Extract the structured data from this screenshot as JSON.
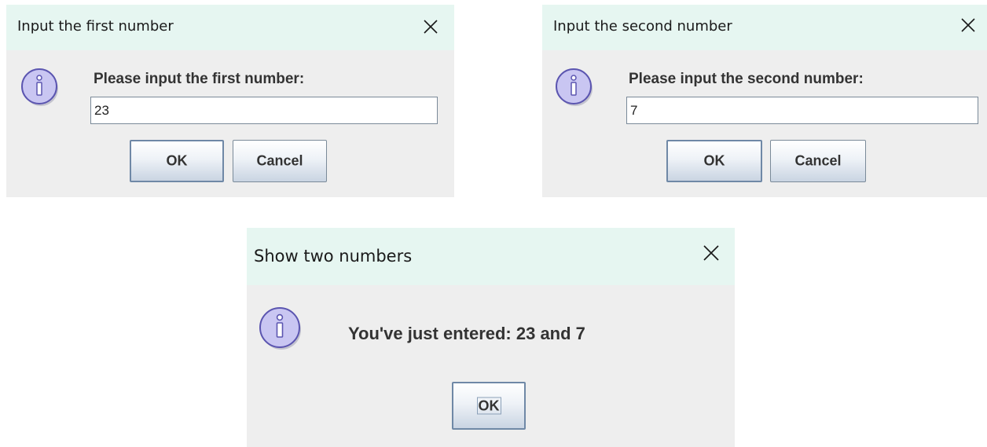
{
  "dialogs": {
    "first": {
      "title": "Input the first number",
      "message": "Please input the first number:",
      "input_value": "23",
      "ok_label": "OK",
      "cancel_label": "Cancel"
    },
    "second": {
      "title": "Input the second number",
      "message": "Please input the second number:",
      "input_value": "7",
      "ok_label": "OK",
      "cancel_label": "Cancel"
    },
    "result": {
      "title": "Show two numbers",
      "message": "You've just entered: 23 and 7",
      "ok_label": "OK"
    }
  },
  "icons": {
    "close": "close-icon",
    "info": "info-icon"
  },
  "colors": {
    "titlebar": "#e6f6f1",
    "dialog_body": "#eeeeee",
    "info_icon_fill": "#c9c6f2",
    "info_icon_stroke": "#5b55b0",
    "button_border": "#7a8a99"
  }
}
